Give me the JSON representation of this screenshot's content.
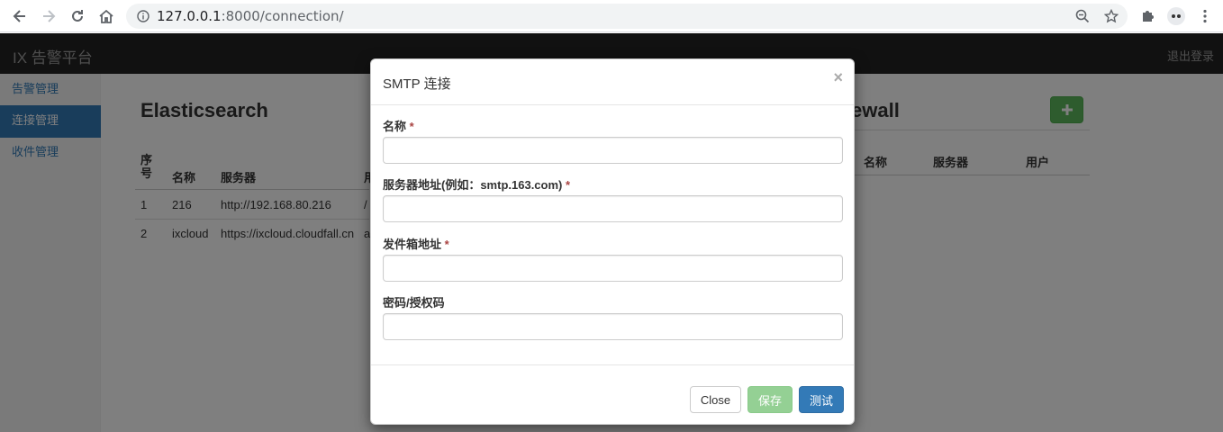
{
  "browser": {
    "url_host": "127.0.0.1",
    "url_rest": ":8000/connection/"
  },
  "app": {
    "brand": "IX 告警平台",
    "logout": "退出登录"
  },
  "sidebar": {
    "items": [
      {
        "label": "告警管理",
        "active": false
      },
      {
        "label": "连接管理",
        "active": true
      },
      {
        "label": "收件管理",
        "active": false
      }
    ]
  },
  "elastic": {
    "title": "Elasticsearch",
    "headers": {
      "no_line1": "序",
      "no_line2": "号",
      "name": "名称",
      "server": "服务器",
      "user": "用"
    },
    "rows": [
      {
        "no": "1",
        "name": "216",
        "server": "http://192.168.80.216",
        "user": "/"
      },
      {
        "no": "2",
        "name": "ixcloud",
        "server": "https://ixcloud.cloudfall.cn",
        "user": "a"
      }
    ]
  },
  "firewall": {
    "title": "ewall",
    "headers": {
      "name": "名称",
      "server": "服务器",
      "user": "用户"
    },
    "add_icon": "plus-icon"
  },
  "modal": {
    "title": "SMTP 连接",
    "close_glyph": "×",
    "required_mark": "*",
    "fields": [
      {
        "label": "名称",
        "required": true,
        "value": "",
        "placeholder": ""
      },
      {
        "label": "服务器地址(例如：smtp.163.com)",
        "required": true,
        "value": "",
        "placeholder": ""
      },
      {
        "label": "发件箱地址",
        "required": true,
        "value": "",
        "placeholder": ""
      },
      {
        "label": "密码/授权码",
        "required": false,
        "value": "",
        "placeholder": ""
      }
    ],
    "buttons": {
      "close": "Close",
      "save": "保存",
      "test": "测试"
    }
  },
  "colors": {
    "primary": "#337ab7",
    "success": "#5cb85c",
    "navbar": "#222222"
  }
}
